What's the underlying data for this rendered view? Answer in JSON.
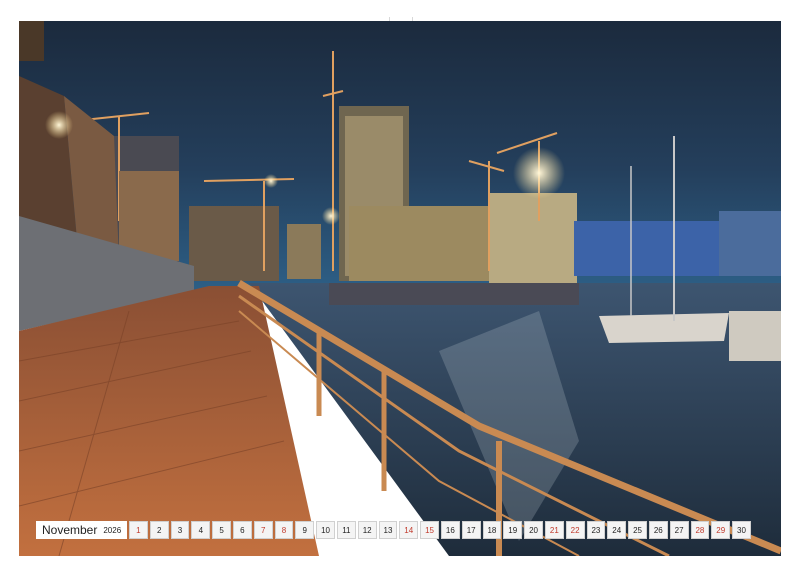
{
  "calendar": {
    "month": "November",
    "year": "2026",
    "days": [
      {
        "n": "1",
        "sun": true
      },
      {
        "n": "2"
      },
      {
        "n": "3"
      },
      {
        "n": "4"
      },
      {
        "n": "5"
      },
      {
        "n": "6"
      },
      {
        "n": "7",
        "sun": true
      },
      {
        "n": "8",
        "sun": true
      },
      {
        "n": "9"
      },
      {
        "n": "10"
      },
      {
        "n": "11"
      },
      {
        "n": "12"
      },
      {
        "n": "13"
      },
      {
        "n": "14",
        "sun": true
      },
      {
        "n": "15",
        "sun": true
      },
      {
        "n": "16"
      },
      {
        "n": "17"
      },
      {
        "n": "18"
      },
      {
        "n": "19"
      },
      {
        "n": "20"
      },
      {
        "n": "21",
        "sun": true
      },
      {
        "n": "22",
        "sun": true
      },
      {
        "n": "23"
      },
      {
        "n": "24"
      },
      {
        "n": "25"
      },
      {
        "n": "26"
      },
      {
        "n": "27"
      },
      {
        "n": "28",
        "sun": true
      },
      {
        "n": "29",
        "sun": true
      },
      {
        "n": "30"
      }
    ]
  },
  "colors": {
    "sky_top": "#1b2a3d",
    "sky_horizon": "#2d5f86",
    "water": "#2a3c50",
    "promenade": "#b5643a",
    "railing": "#c98a52"
  },
  "photo_subject": "harbour-promenade-night-icon"
}
